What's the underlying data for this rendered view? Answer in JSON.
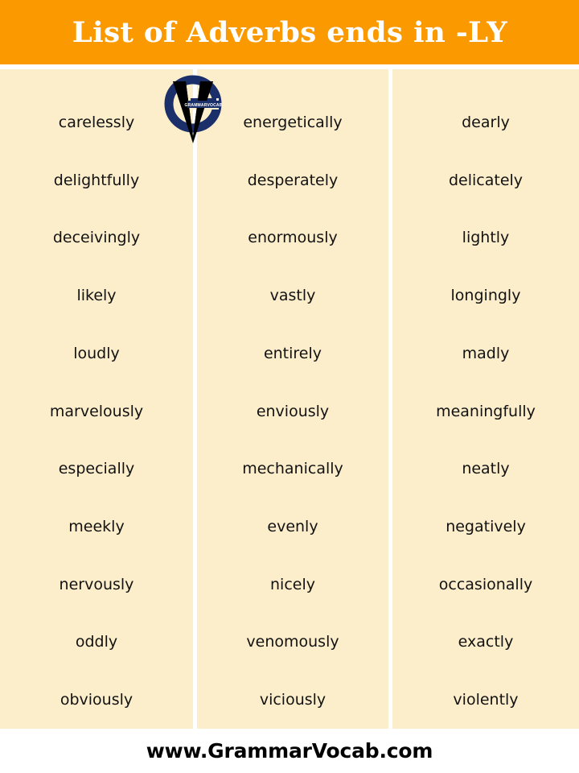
{
  "header": {
    "title": "List of Adverbs ends in -LY",
    "background_color": "#fb9a00",
    "text_color": "#ffffff"
  },
  "logo": {
    "name": "grammarvocab-logo",
    "banner_text": "GRAMMARVOCAB",
    "ring_color": "#1b2f6b",
    "v_color": "#000000",
    "banner_color": "#1b2f6b"
  },
  "content": {
    "background_color": "#fdeecb",
    "divider_color": "#ffffff",
    "text_color": "#121212",
    "columns": [
      {
        "index": 1,
        "words": [
          "carelessly",
          "delightfully",
          "deceivingly",
          "likely",
          "loudly",
          "marvelously",
          "especially",
          "meekly",
          "nervously",
          "oddly",
          "obviously"
        ]
      },
      {
        "index": 2,
        "words": [
          "energetically",
          "desperately",
          "enormously",
          "vastly",
          "entirely",
          "enviously",
          "mechanically",
          "evenly",
          "nicely",
          "venomously",
          "viciously"
        ]
      },
      {
        "index": 3,
        "words": [
          "dearly",
          "delicately",
          "lightly",
          "longingly",
          "madly",
          "meaningfully",
          "neatly",
          "negatively",
          "occasionally",
          "exactly",
          "violently"
        ]
      }
    ]
  },
  "footer": {
    "website": "www.GrammarVocab.com",
    "text_color": "#000000",
    "background_color": "#ffffff"
  }
}
